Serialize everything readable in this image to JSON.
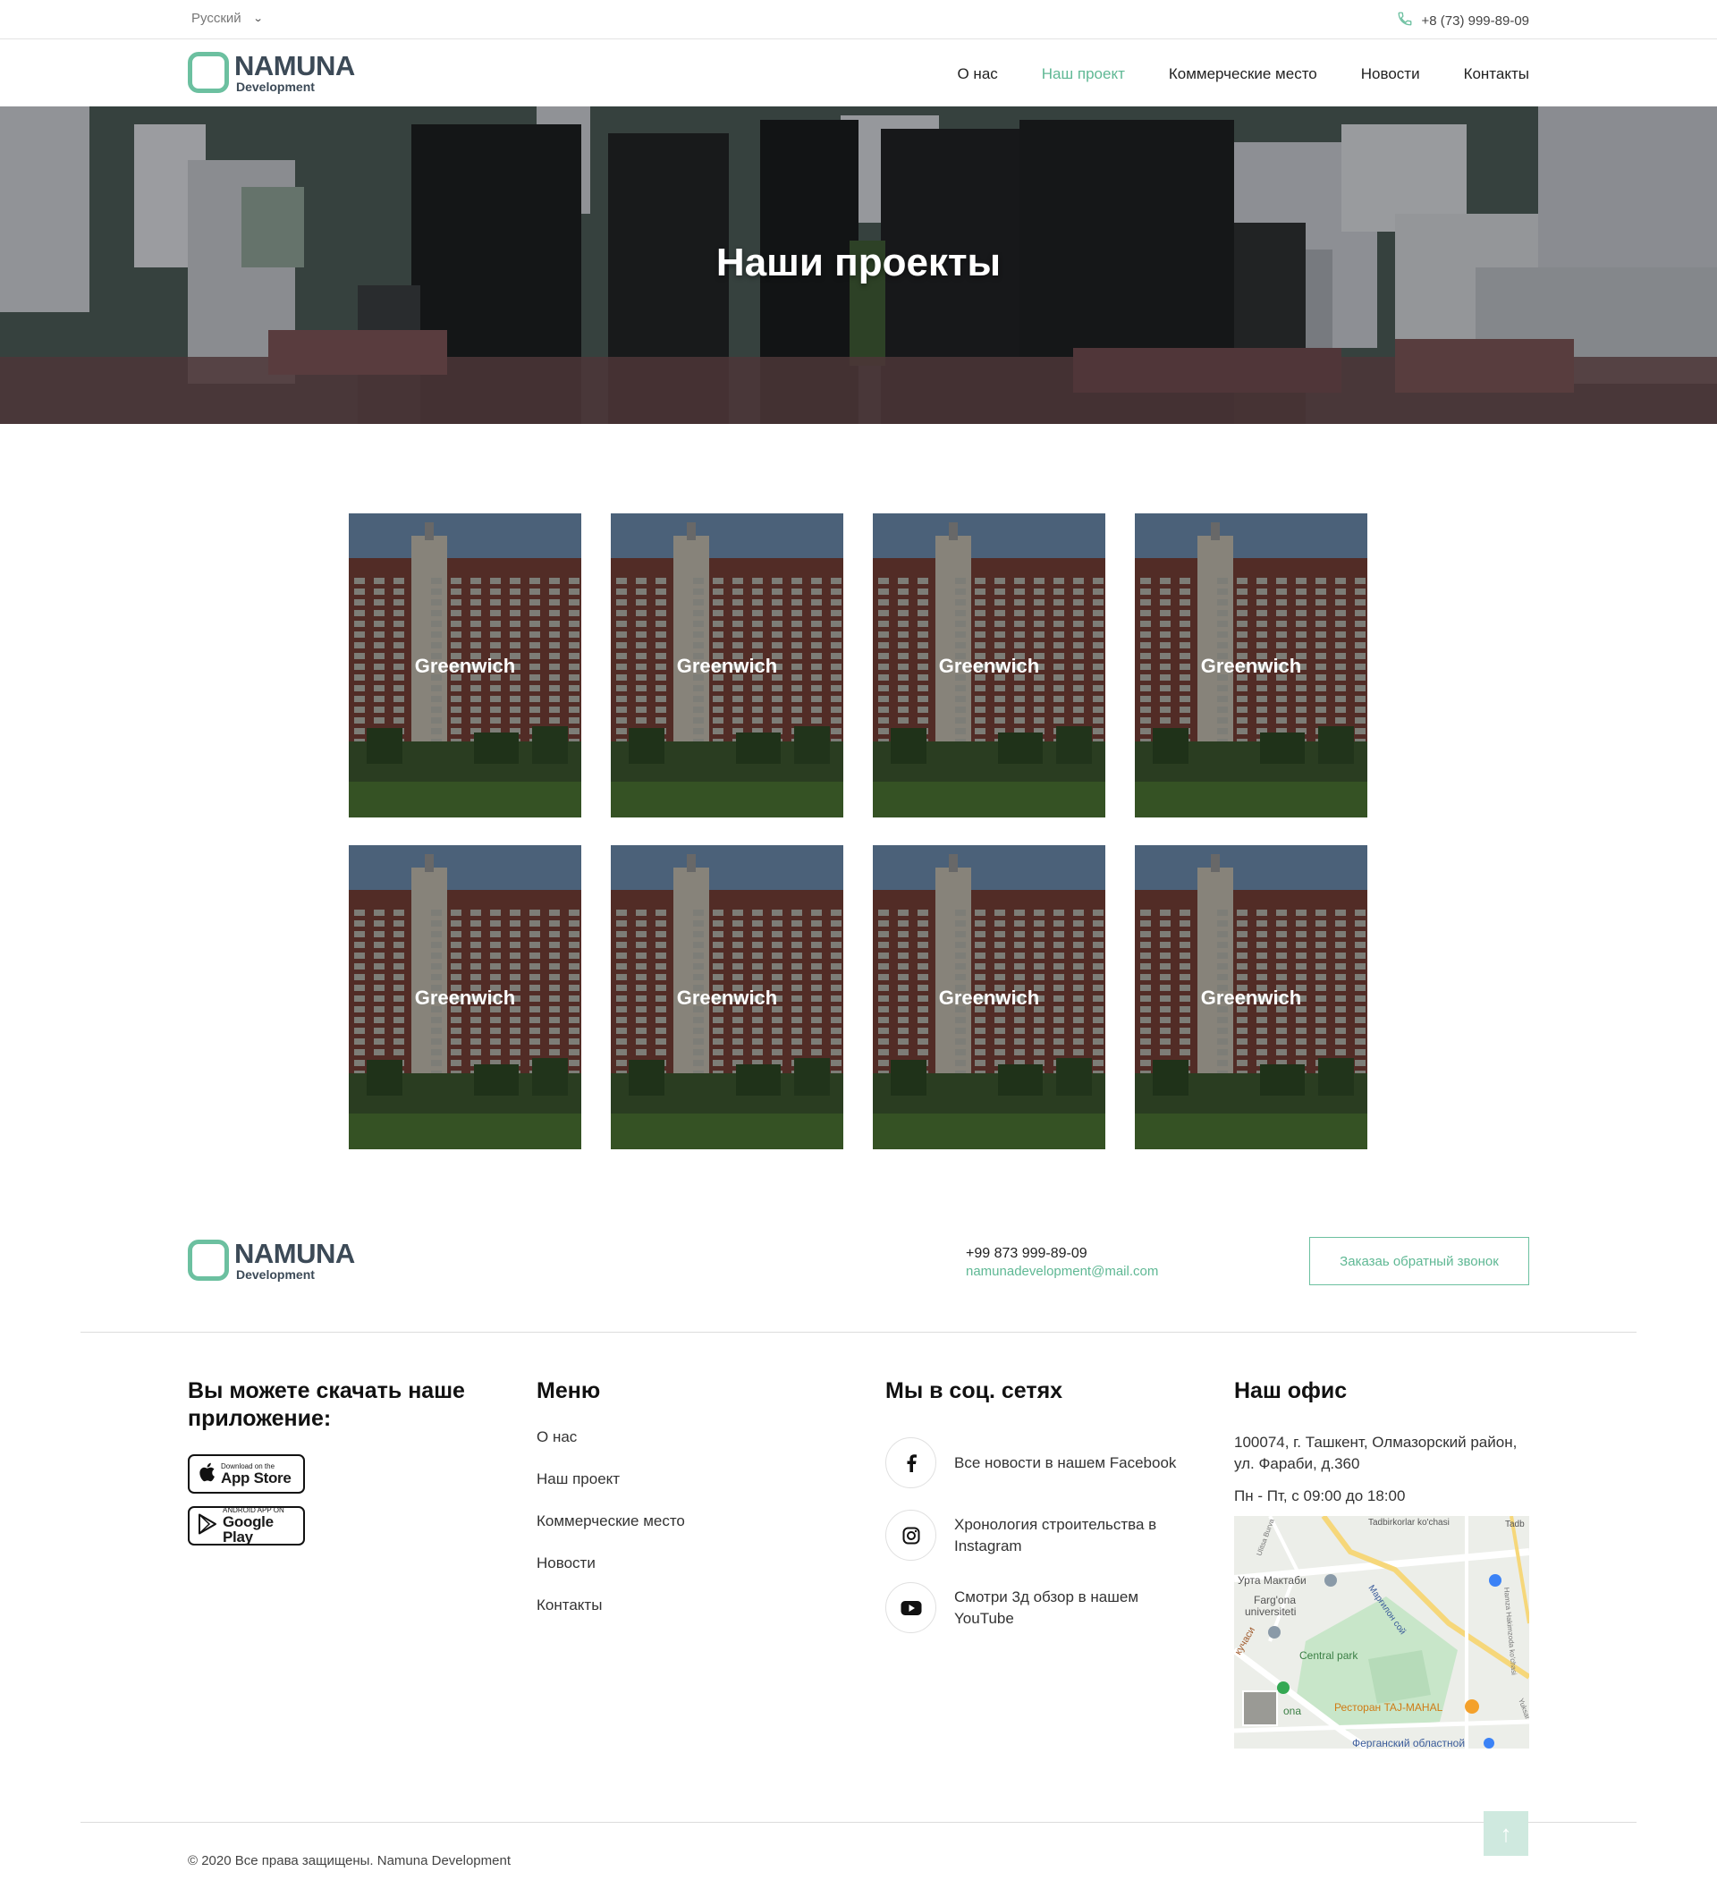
{
  "topbar": {
    "language": "Русский",
    "phone": "+8 (73) 999-89-09"
  },
  "brand": {
    "name": "NAMUNA",
    "sub": "Development",
    "accent": "#6cc0a0"
  },
  "nav": {
    "items": [
      {
        "label": "О нас",
        "active": false
      },
      {
        "label": "Наш проект",
        "active": true
      },
      {
        "label": "Коммерческие место",
        "active": false
      },
      {
        "label": "Новости",
        "active": false
      },
      {
        "label": "Контакты",
        "active": false
      }
    ]
  },
  "hero": {
    "title": "Наши проекты"
  },
  "projects": [
    {
      "title": "Greenwich"
    },
    {
      "title": "Greenwich"
    },
    {
      "title": "Greenwich"
    },
    {
      "title": "Greenwich"
    },
    {
      "title": "Greenwich"
    },
    {
      "title": "Greenwich"
    },
    {
      "title": "Greenwich"
    },
    {
      "title": "Greenwich"
    }
  ],
  "footer": {
    "phone": "+99 873 999-89-09",
    "email": "namunadevelopment@mail.com",
    "callback_label": "Заказаь обратный звонок",
    "app": {
      "heading": "Вы можете скачать наше приложение:",
      "appstore_small": "Download on the",
      "appstore_big": "App Store",
      "googleplay_small": "ANDROID APP ON",
      "googleplay_big": "Google Play"
    },
    "menu": {
      "heading": "Меню",
      "items": [
        "О нас",
        "Наш проект",
        "Коммерческие место",
        "Новости",
        "Контакты"
      ]
    },
    "social": {
      "heading": "Мы в соц. сетях",
      "items": [
        {
          "icon": "facebook-icon",
          "text": "Все новости в нашем Facebook"
        },
        {
          "icon": "instagram-icon",
          "text": "Хронология строительства в Instagram"
        },
        {
          "icon": "youtube-icon",
          "text": "Смотри 3д обзор в нашем YouTube"
        }
      ]
    },
    "office": {
      "heading": "Наш офис",
      "address": "100074, г. Ташкент, Олмазорский район, ул. Фараби, д.360",
      "hours": "Пн - Пт, с 09:00 до 18:00",
      "map_labels": {
        "street_top": "Tadbirkorlar ko'chasi",
        "street_top_right": "Tadb",
        "school": "Урта Мактаби",
        "university_1": "Farg'ona",
        "university_2": "universiteti",
        "park": "Central park",
        "restaurant": "Ресторан TAJ-MAHAL",
        "region": "Ферганский областной",
        "street_left": "кучаси",
        "street_right": "Марғилон сой",
        "fargona": "ona",
        "ulitsa": "Ulitsa Burva",
        "hamza": "Hamza Hakimzoda ko'chasi",
        "yukori": "Yuksal"
      }
    },
    "copyright": "© 2020 Все права защищены. Namuna Development"
  }
}
